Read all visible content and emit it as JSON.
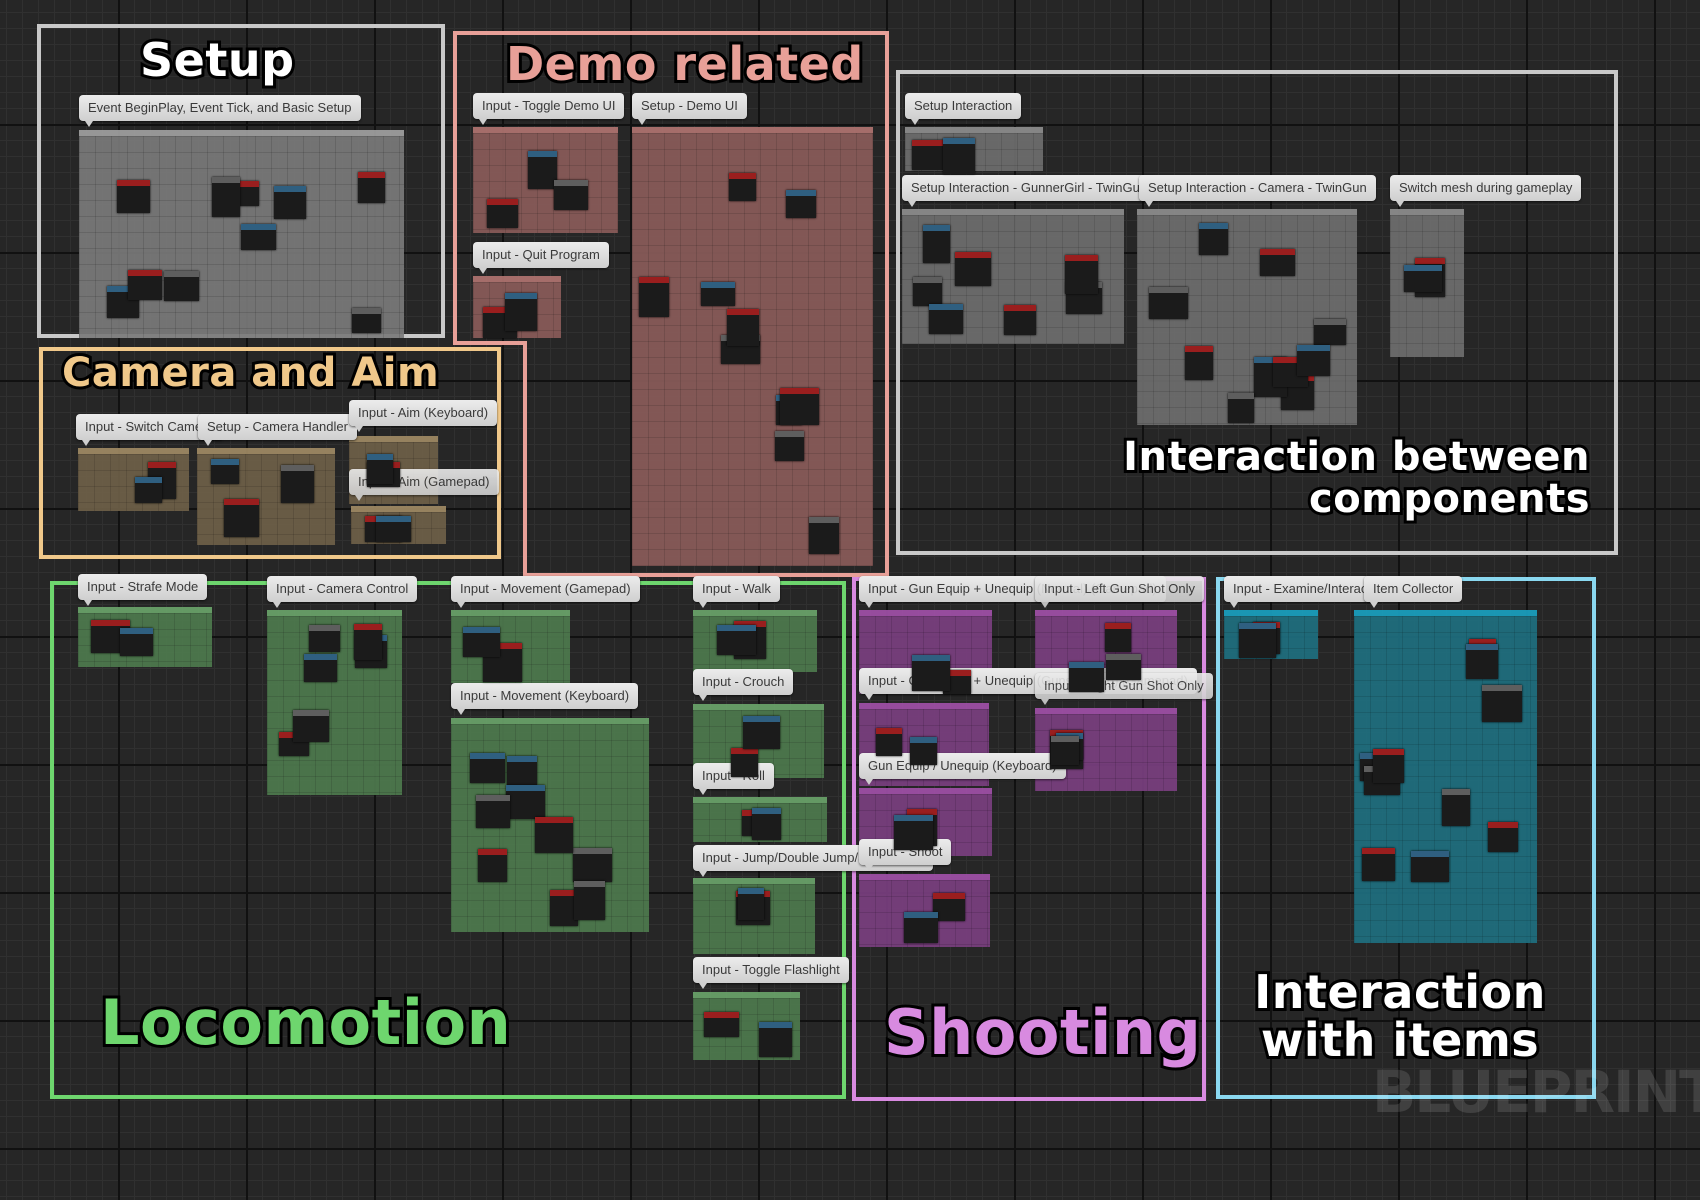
{
  "colors": {
    "setup": "#c8c8c8",
    "demo": "#e8a098",
    "camera": "#f0c88a",
    "interaction_components": "#c8c8c8",
    "locomotion": "#6ed66e",
    "shooting": "#d88ae0",
    "items": "#8ad8f0"
  },
  "groups": {
    "setup": {
      "title": "Setup",
      "comments": [
        "Event BeginPlay, Event Tick, and Basic Setup"
      ]
    },
    "demo": {
      "title": "Demo related",
      "comments": [
        "Input - Toggle Demo UI",
        "Setup - Demo UI",
        "Input - Quit Program"
      ]
    },
    "camera": {
      "title": "Camera and Aim",
      "comments": [
        "Input - Switch Camera",
        "Setup - Camera Handler",
        "Input - Aim (Keyboard)",
        "Input - Aim (Gamepad)"
      ]
    },
    "interaction_components": {
      "title_line1": "Interaction between",
      "title_line2": "components",
      "comments": [
        "Setup Interaction",
        "Setup Interaction - GunnerGirl - TwinGun",
        "Setup Interaction - Camera - TwinGun",
        "Switch mesh during gameplay"
      ]
    },
    "locomotion": {
      "title": "Locomotion",
      "comments": [
        "Input - Strafe Mode",
        "Input - Camera Control",
        "Input - Movement (Gamepad)",
        "Input - Movement (Keyboard)",
        "Input - Walk",
        "Input - Crouch",
        "Input - Roll",
        "Input - Jump/Double Jump/Somersault",
        "Input - Toggle Flashlight"
      ]
    },
    "shooting": {
      "title": "Shooting",
      "comments": [
        "Input - Gun Equip + Unequip (Normal) (Gamepad)",
        "Input - Left Gun Shot Only",
        "Input - Gun Equip + Unequip (Gunspinning) (Gamepad)",
        "Input - Right Gun Shot Only",
        "Gun Equip / Unequip (Keyboard)",
        "Input - Shoot"
      ]
    },
    "items": {
      "title_line1": "Interaction",
      "title_line2": "with items",
      "comments": [
        "Input - Examine/Interact",
        "Item Collector"
      ]
    }
  },
  "watermark": "BLUEPRINT"
}
